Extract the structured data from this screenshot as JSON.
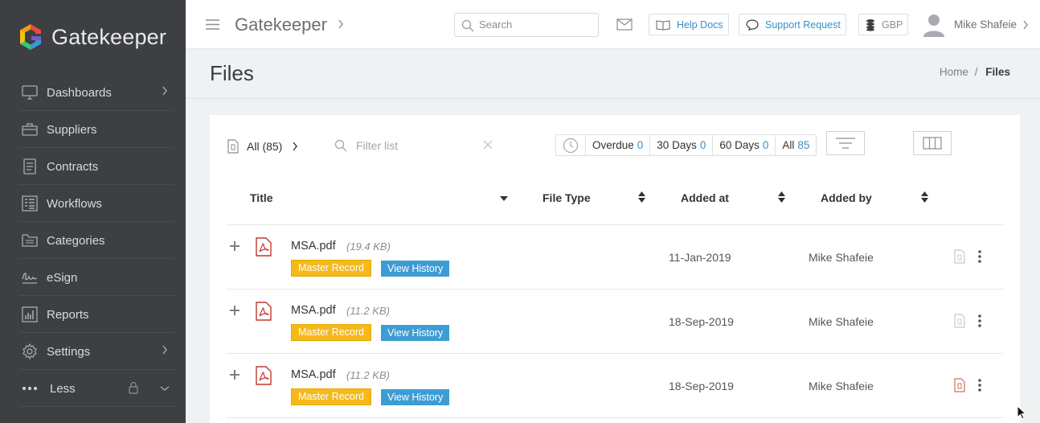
{
  "brand": {
    "name": "Gatekeeper"
  },
  "sidebar": {
    "items": [
      {
        "label": "Dashboards",
        "icon": "monitor-icon",
        "has_chevron": true
      },
      {
        "label": "Suppliers",
        "icon": "briefcase-icon",
        "has_chevron": false
      },
      {
        "label": "Contracts",
        "icon": "document-icon",
        "has_chevron": false
      },
      {
        "label": "Workflows",
        "icon": "workflow-icon",
        "has_chevron": false
      },
      {
        "label": "Categories",
        "icon": "folder-icon",
        "has_chevron": false
      },
      {
        "label": "eSign",
        "icon": "signature-icon",
        "has_chevron": false
      },
      {
        "label": "Reports",
        "icon": "bar-chart-icon",
        "has_chevron": false
      },
      {
        "label": "Settings",
        "icon": "gear-icon",
        "has_chevron": true
      },
      {
        "label": "Less",
        "icon": "more-dots-icon",
        "has_chevron": true
      }
    ]
  },
  "topbar": {
    "app_crumb": "Gatekeeper",
    "search_placeholder": "Search",
    "help_label": "Help Docs",
    "support_label": "Support Request",
    "currency_label": "GBP",
    "user_name": "Mike Shafeie"
  },
  "page": {
    "title": "Files",
    "breadcrumb": {
      "home": "Home",
      "separator": "/",
      "current": "Files"
    }
  },
  "toolbar": {
    "all_label": "All (85)",
    "filter_placeholder": "Filter list",
    "due_filters": [
      {
        "label": "Overdue",
        "count": "0"
      },
      {
        "label": "30 Days",
        "count": "0"
      },
      {
        "label": "60 Days",
        "count": "0"
      },
      {
        "label": "All",
        "count": "85"
      }
    ]
  },
  "table": {
    "columns": {
      "title": "Title",
      "file_type": "File Type",
      "added_at": "Added at",
      "added_by": "Added by"
    },
    "rows": [
      {
        "name": "MSA.pdf",
        "size": "(19.4 KB)",
        "badge_master": "Master Record",
        "badge_history": "View History",
        "added_at": "11-Jan-2019",
        "added_by": "Mike Shafeie"
      },
      {
        "name": "MSA.pdf",
        "size": "(11.2 KB)",
        "badge_master": "Master Record",
        "badge_history": "View History",
        "added_at": "18-Sep-2019",
        "added_by": "Mike Shafeie"
      },
      {
        "name": "MSA.pdf",
        "size": "(11.2 KB)",
        "badge_master": "Master Record",
        "badge_history": "View History",
        "added_at": "18-Sep-2019",
        "added_by": "Mike Shafeie"
      }
    ]
  },
  "colors": {
    "sidebar_bg": "#3d3f42",
    "accent_blue": "#3d9cd4",
    "master_badge": "#f5b91a",
    "pdf_red": "#c0392b"
  }
}
